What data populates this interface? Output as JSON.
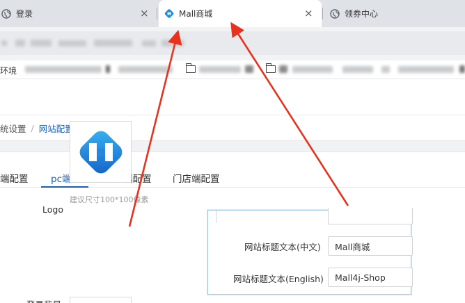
{
  "browser": {
    "tabs": [
      {
        "title": "登录",
        "active": false
      },
      {
        "title": "Mall商城",
        "active": true
      },
      {
        "title": "领券中心",
        "active": false
      }
    ],
    "close_glyph": "×"
  },
  "bookmarks": {
    "first_label": "环境"
  },
  "breadcrumb": {
    "parent": "统设置",
    "separator": "/",
    "current": "网站配置"
  },
  "settings_tabs": [
    {
      "label": "端配置",
      "active": false
    },
    {
      "label": "pc端配置",
      "active": true
    },
    {
      "label": "h5端配置",
      "active": false
    },
    {
      "label": "门店端配置",
      "active": false
    }
  ],
  "form": {
    "logo_label": "Logo",
    "logo_hint": "建议尺寸100*100像素",
    "next_label_partial": "登录背景"
  },
  "callout": {
    "title_cn_label": "网站标题文本(中文)",
    "title_cn_value": "Mall商城",
    "title_en_label": "网站标题文本(English)",
    "title_en_value": "Mall4j-Shop"
  },
  "colors": {
    "accent": "#1a5eb8",
    "arrow": "#e8321e",
    "logo_blue": "#1f8fe0"
  }
}
